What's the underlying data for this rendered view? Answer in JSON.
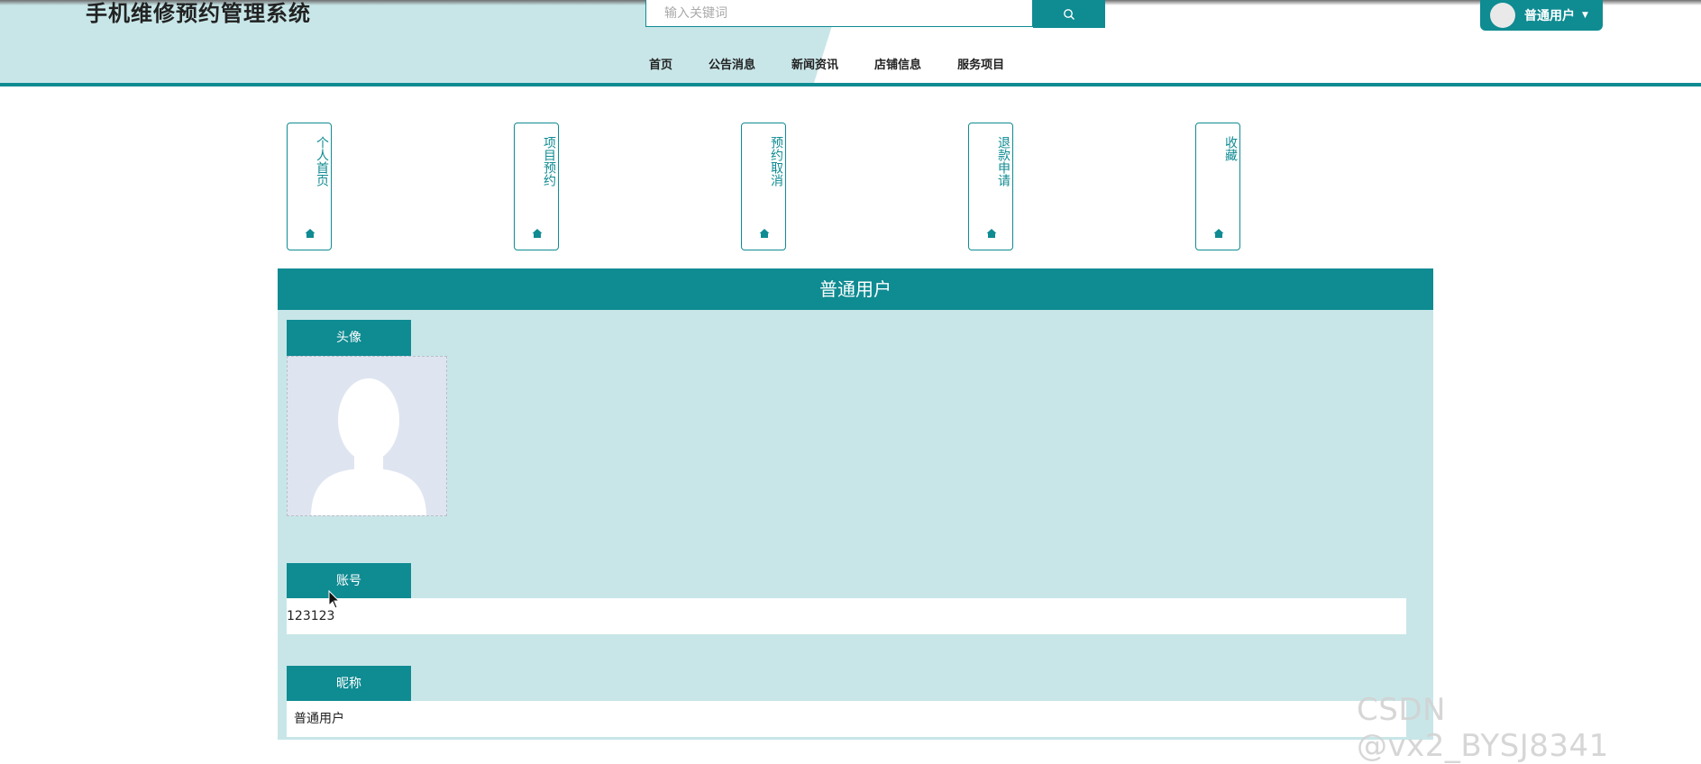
{
  "header": {
    "site_title": "手机维修预约管理系统",
    "search_placeholder": "输入关键词",
    "user_name": "普通用户",
    "nav": [
      "首页",
      "公告消息",
      "新闻资讯",
      "店铺信息",
      "服务项目"
    ]
  },
  "quick_links": [
    {
      "label": "个人首页",
      "icon": "home-icon"
    },
    {
      "label": "项目预约",
      "icon": "home-icon"
    },
    {
      "label": "预约取消",
      "icon": "home-icon"
    },
    {
      "label": "退款申请",
      "icon": "home-icon"
    },
    {
      "label": "收藏",
      "icon": "home-icon"
    }
  ],
  "panel": {
    "title": "普通用户",
    "avatar_label": "头像",
    "account_label": "账号",
    "account_value": "123123",
    "nickname_label": "昵称",
    "nickname_value": "普通用户"
  },
  "watermark": "CSDN @vx2_BYSJ8341",
  "colors": {
    "accent": "#0f8b92",
    "tint": "#c8e6e8"
  }
}
